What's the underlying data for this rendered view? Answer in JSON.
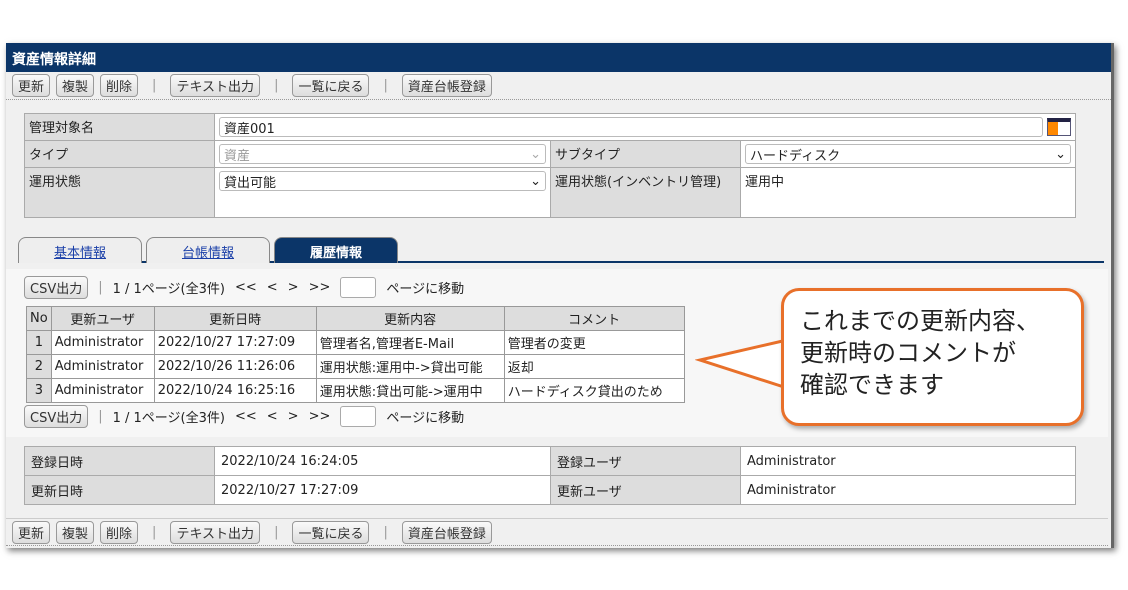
{
  "window": {
    "title": "資産情報詳細"
  },
  "toolbar": {
    "update": "更新",
    "copy": "複製",
    "delete": "削除",
    "text_export": "テキスト出力",
    "back_to_list": "一覧に戻る",
    "register_ledger": "資産台帳登録",
    "separator": "|"
  },
  "form": {
    "name_label": "管理対象名",
    "name_value": "資産001",
    "type_label": "タイプ",
    "type_value": "資産",
    "subtype_label": "サブタイプ",
    "subtype_value": "ハードディスク",
    "status_label": "運用状態",
    "status_value": "貸出可能",
    "inv_status_label": "運用状態(インベントリ管理)",
    "inv_status_value": "運用中"
  },
  "tabs": [
    "基本情報",
    "台帳情報",
    "履歴情報"
  ],
  "pager": {
    "csv": "CSV出力",
    "page_info": "1 / 1ページ(全3件)",
    "first": "<<",
    "prev": "<",
    "next": ">",
    "last": ">>",
    "goto": "ページに移動"
  },
  "history": {
    "headers": [
      "No",
      "更新ユーザ",
      "更新日時",
      "更新内容",
      "コメント"
    ],
    "rows": [
      [
        "1",
        "Administrator",
        "2022/10/27 17:27:09",
        "管理者名,管理者E-Mail",
        "管理者の変更"
      ],
      [
        "2",
        "Administrator",
        "2022/10/26 11:26:06",
        "運用状態:運用中->貸出可能",
        "返却"
      ],
      [
        "3",
        "Administrator",
        "2022/10/24 16:25:16",
        "運用状態:貸出可能->運用中",
        "ハードディスク貸出のため"
      ]
    ]
  },
  "info": {
    "created_label": "登録日時",
    "created_value": "2022/10/24 16:24:05",
    "created_user_label": "登録ユーザ",
    "created_user_value": "Administrator",
    "updated_label": "更新日時",
    "updated_value": "2022/10/27 17:27:09",
    "updated_user_label": "更新ユーザ",
    "updated_user_value": "Administrator"
  },
  "callout": {
    "line1": "これまでの更新内容、",
    "line2": "更新時のコメントが",
    "line3": "確認できます"
  },
  "colors": {
    "navy": "#0b3568",
    "callout": "#e8702a"
  }
}
